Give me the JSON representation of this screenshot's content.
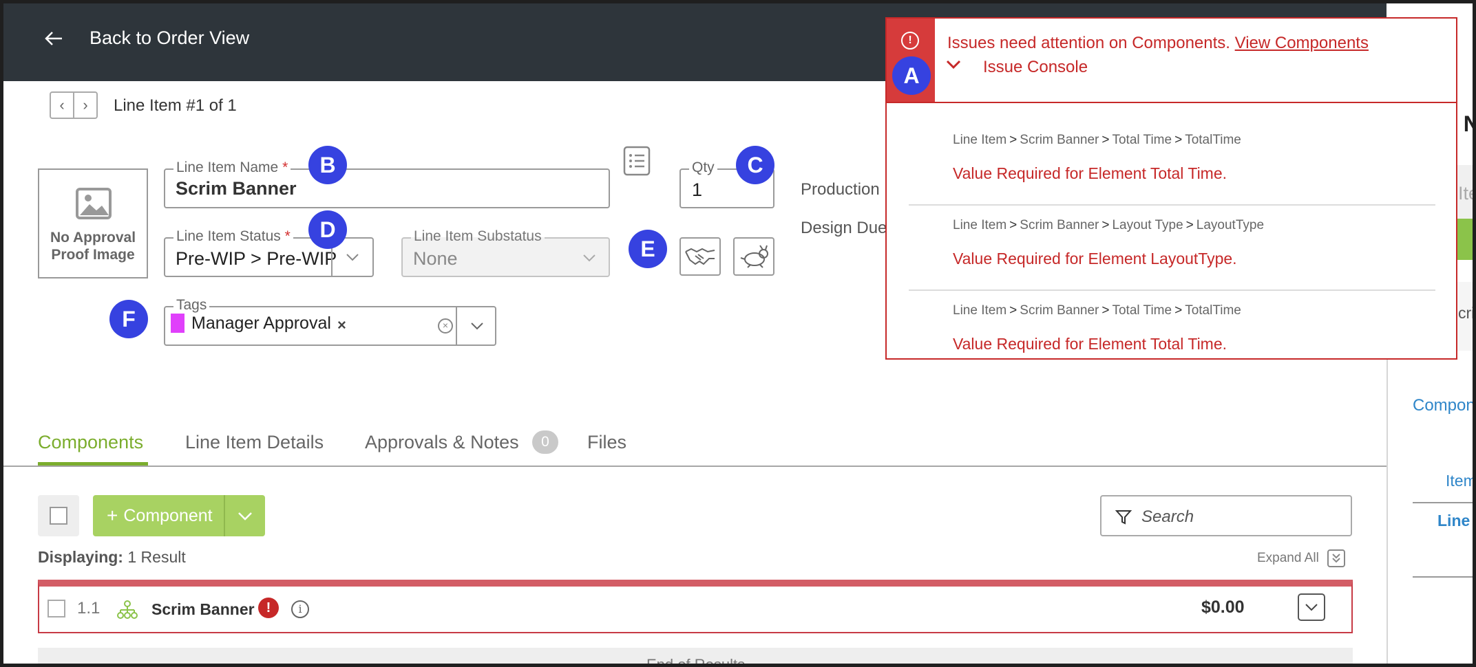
{
  "header": {
    "back_label": "Back to Order View"
  },
  "pager": {
    "label": "Line Item #1 of 1"
  },
  "approval_image": {
    "line1": "No Approval",
    "line2": "Proof Image"
  },
  "fields": {
    "name": {
      "label": "Line Item Name",
      "required_mark": "*",
      "value": "Scrim Banner"
    },
    "qty": {
      "label": "Qty",
      "value": "1"
    },
    "status": {
      "label": "Line Item Status",
      "required_mark": "*",
      "value": "Pre-WIP > Pre-WIP"
    },
    "substatus": {
      "label": "Line Item Substatus",
      "value": "None"
    },
    "tags": {
      "label": "Tags",
      "tag": "Manager Approval",
      "tag_color": "#e040fb"
    }
  },
  "side_labels": {
    "production": "Production",
    "design_due": "Design Due"
  },
  "markers": {
    "a": "A",
    "b": "B",
    "c": "C",
    "d": "D",
    "e": "E",
    "f": "F"
  },
  "tabs": [
    {
      "label": "Components"
    },
    {
      "label": "Line Item Details"
    },
    {
      "label": "Approvals & Notes",
      "count": "0"
    },
    {
      "label": "Files"
    }
  ],
  "toolbar": {
    "add_label": "Component",
    "search_placeholder": "Search"
  },
  "results": {
    "displaying_label": "Displaying:",
    "displaying_value": "1 Result",
    "expand_all": "Expand All"
  },
  "row": {
    "number": "1.1",
    "name": "Scrim Banner",
    "error_mark": "!",
    "price": "$0.00"
  },
  "end_of_results": "End of Results",
  "issue_console": {
    "message": "Issues need attention on Components.",
    "link": "View Components",
    "console_label": "Issue Console",
    "items": [
      {
        "path": [
          "Line Item",
          "Scrim Banner",
          "Total Time",
          "TotalTime"
        ],
        "error": "Value Required for Element Total Time."
      },
      {
        "path": [
          "Line Item",
          "Scrim Banner",
          "Layout Type",
          "LayoutType"
        ],
        "error": "Value Required for Element LayoutType."
      },
      {
        "path": [
          "Line Item",
          "Scrim Banner",
          "Total Time",
          "TotalTime"
        ],
        "error": "Value Required for Element Total Time."
      }
    ]
  },
  "right_panel": {
    "t1": "I N",
    "t2": "Ite",
    "t3": "cri",
    "t4": "Compon",
    "t5": "Item",
    "t6": "Line"
  },
  "colors": {
    "accent_green": "#7bad2d",
    "error_red": "#c62828",
    "marker_blue": "#3642e0",
    "header_bg": "#2e353b"
  }
}
